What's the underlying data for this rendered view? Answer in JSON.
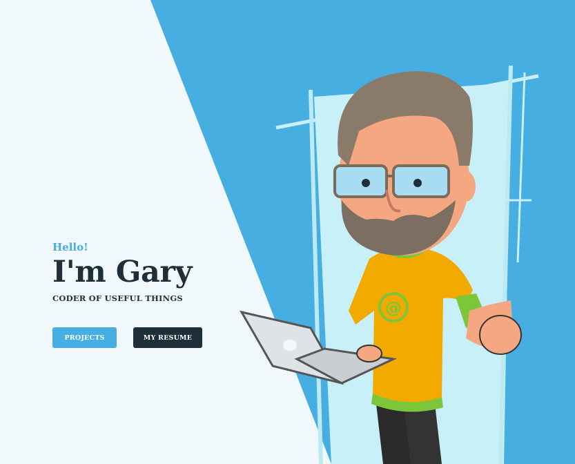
{
  "hero": {
    "greeting": "Hello!",
    "name": "I'm Gary",
    "tagline": "CODER OF USEFUL THINGS"
  },
  "buttons": {
    "projects_label": "PROJECTS",
    "resume_label": "MY RESUME"
  },
  "illustration": {
    "icon": "cartoon-developer-with-laptop",
    "shirt_symbol": "@"
  },
  "colors": {
    "accent_blue": "#46aee0",
    "dark_navy": "#1f2f3a",
    "light_bg": "#f0f8fc",
    "shirt_yellow": "#f2a900",
    "shirt_green": "#7cc63a"
  }
}
